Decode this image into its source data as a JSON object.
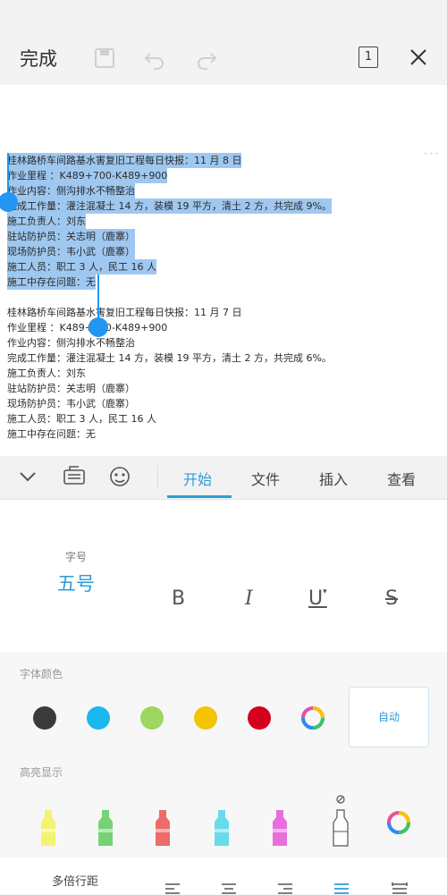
{
  "toolbar": {
    "done_label": "完成",
    "page_count": "1"
  },
  "document": {
    "lines": [
      "桂林路桥车间路基水害复旧工程每日快报：11 月 8 日",
      "作业里程 ：K489+700-K489+900",
      "作业内容：侧沟排水不畅整治",
      "完成工作量：灌注混凝土 14 方，装模 19 平方，清土 2 方，共完成 9%。",
      "施工负责人：刘东",
      "驻站防护员：关志明（鹿寨）",
      "现场防护员：韦小武（鹿寨）",
      "施工人员：职工 3 人，民工 16 人",
      "施工中存在问题：无",
      "",
      "桂林路桥车间路基水害复旧工程每日快报：11 月 7 日",
      "作业里程 ：K489+700-K489+900",
      "作业内容：侧沟排水不畅整治",
      "完成工作量：灌注混凝土 14 方，装模 19 平方，清土 2 方，共完成 6%。",
      "施工负责人：刘东",
      "驻站防护员：关志明（鹿寨）",
      "现场防护员：韦小武（鹿寨）",
      "施工人员：职工 3 人，民工 16 人",
      "施工中存在问题：无"
    ]
  },
  "tabs": [
    {
      "label": "开始",
      "active": true
    },
    {
      "label": "文件",
      "active": false
    },
    {
      "label": "插入",
      "active": false
    },
    {
      "label": "查看",
      "active": false
    }
  ],
  "font": {
    "size_label": "字号",
    "size_value": "五号",
    "bold": "B",
    "italic": "I",
    "underline": "U",
    "strike": "S"
  },
  "font_color": {
    "title": "字体颜色",
    "swatches": [
      "#3a3a3a",
      "#19b8ee",
      "#9ed660",
      "#f5c400",
      "#d6001c"
    ],
    "auto_label": "自动"
  },
  "highlight": {
    "title": "高亮显示",
    "markers": [
      "#f2f25a",
      "#5ecb5e",
      "#e9534f",
      "#4fd6e6",
      "#e457d8"
    ]
  },
  "paragraph": {
    "line_spacing_label": "多倍行距"
  }
}
